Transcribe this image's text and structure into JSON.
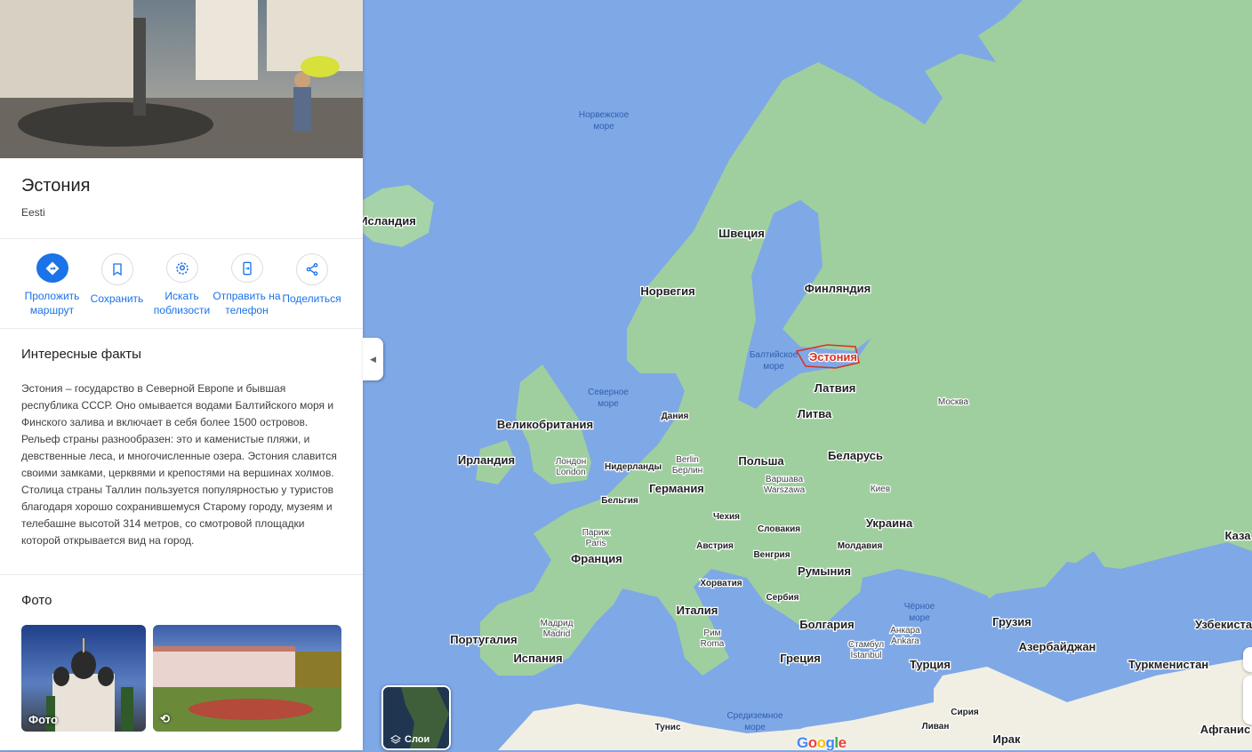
{
  "place": {
    "title": "Эстония",
    "subtitle": "Eesti"
  },
  "actions": [
    {
      "label": "Проложить маршрут",
      "icon": "directions-icon"
    },
    {
      "label": "Сохранить",
      "icon": "bookmark-icon"
    },
    {
      "label": "Искать поблизости",
      "icon": "nearby-icon"
    },
    {
      "label": "Отправить на телефон",
      "icon": "send-to-phone-icon"
    },
    {
      "label": "Поделиться",
      "icon": "share-icon"
    }
  ],
  "facts": {
    "heading": "Интересные факты",
    "text": "Эстония – государство в Северной Европе и бывшая республика СССР. Оно омывается водами Балтийского моря и Финского залива и включает в себя более 1500 островов. Рельеф страны разнообразен: это и каменистые пляжи, и девственные леса, и многочисленные озера. Эстония славится своими замками, церквями и крепостями на вершинах холмов. Столица страны Таллин пользуется популярностью у туристов благодаря хорошо сохранившемуся Старому городу, музеям и телебашне высотой 314 метров, со смотровой площадки которой открывается вид на город."
  },
  "photos": {
    "heading": "Фото",
    "items": [
      {
        "caption": "Фото"
      },
      {
        "caption": ""
      }
    ]
  },
  "layers": {
    "label": "Слои"
  },
  "attribution": {
    "logo": "Google"
  },
  "colors": {
    "water": "#7fa8e6",
    "land": "#9fcf9f",
    "desert": "#f1efe4",
    "accent": "#1a73e8",
    "highlight": "#d93025"
  },
  "map_labels": {
    "seas": [
      "Норвежское море",
      "Балтийское море",
      "Северное море",
      "Чёрное море",
      "Средиземное море"
    ],
    "countries": [
      "Исландия",
      "Швеция",
      "Финляндия",
      "Норвегия",
      "Латвия",
      "Литва",
      "Дания",
      "Великобритания",
      "Ирландия",
      "Нидерланды",
      "Германия",
      "Польша",
      "Беларусь",
      "Бельгия",
      "Чехия",
      "Украина",
      "Франция",
      "Австрия",
      "Словакия",
      "Молдавия",
      "Венгрия",
      "Румыния",
      "Хорватия",
      "Сербия",
      "Италия",
      "Болгария",
      "Португалия",
      "Испания",
      "Греция",
      "Турция",
      "Грузия",
      "Азербайджан",
      "Туркменистан",
      "Узбекистан",
      "Сирия",
      "Ирак",
      "Ливан",
      "Тунис",
      "Афганис",
      "Каза"
    ],
    "highlighted": "Эстония",
    "cities": [
      {
        "name": "Лондон",
        "alt": "London"
      },
      {
        "name": "Berlin",
        "alt": "Берлин"
      },
      {
        "name": "Варшава",
        "alt": "Warszawa"
      },
      {
        "name": "Киев",
        "alt": ""
      },
      {
        "name": "Москва",
        "alt": ""
      },
      {
        "name": "Париж",
        "alt": "Paris"
      },
      {
        "name": "Рим",
        "alt": "Roma"
      },
      {
        "name": "Мадрид",
        "alt": "Madrid"
      },
      {
        "name": "Анкара",
        "alt": "Ankara"
      },
      {
        "name": "Стамбул",
        "alt": "İstanbul"
      }
    ]
  }
}
